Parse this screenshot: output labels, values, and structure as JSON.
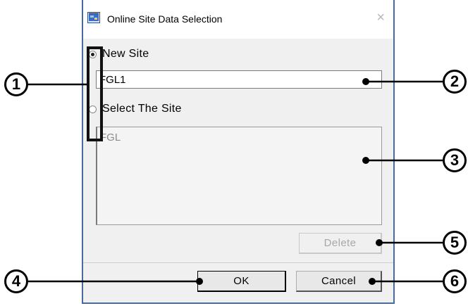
{
  "window": {
    "title": "Online Site Data Selection",
    "close_glyph": "×",
    "icon": "app-window-icon"
  },
  "radios": {
    "new_site": {
      "label": "New Site",
      "checked": true
    },
    "select_site": {
      "label": "Select The Site",
      "checked": false
    }
  },
  "site_name_input": {
    "value": "FGL1"
  },
  "site_list": {
    "items": [
      "FGL"
    ]
  },
  "buttons": {
    "delete": "Delete",
    "ok": "OK",
    "cancel": "Cancel"
  },
  "callouts": {
    "c1": "1",
    "c2": "2",
    "c3": "3",
    "c4": "4",
    "c5": "5",
    "c6": "6"
  },
  "colors": {
    "window_border": "#4a6a9a",
    "client_bg": "#f0f0f0",
    "annotation": "#000000"
  }
}
